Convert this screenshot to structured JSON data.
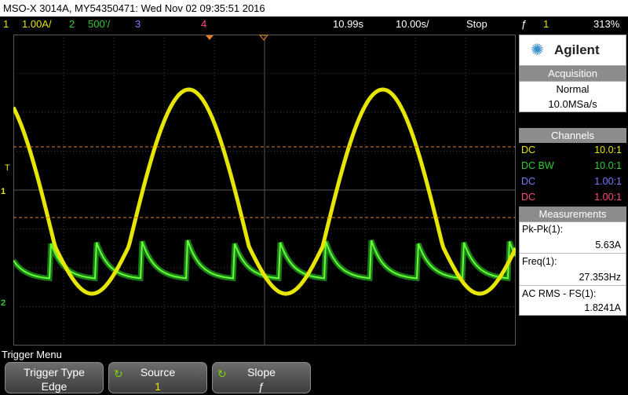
{
  "title_bar": {
    "text": "MSO-X 3014A, MY54350471: Wed Nov 02 09:35:51 2016"
  },
  "status_line": {
    "ch1_num": "1",
    "ch1_scale": "1.00A/",
    "ch2_num": "2",
    "ch2_scale": "500’/",
    "ch3_num": "3",
    "ch4_num": "4",
    "delay": "10.99s",
    "timebase": "10.00s/",
    "run_state": "Stop",
    "trigger_icon": "ƒ",
    "trigger_source": "1",
    "trigger_level": "313%"
  },
  "markers": {
    "trigger": "T",
    "ch1": "1",
    "ch2": "2"
  },
  "right_panel": {
    "brand": "Agilent",
    "acquisition": {
      "header": "Acquisition",
      "mode": "Normal",
      "rate": "10.0MSa/s"
    },
    "channels": {
      "header": "Channels",
      "rows": [
        {
          "coupling": "DC",
          "probe": "10.0:1",
          "color": "#e6e600"
        },
        {
          "coupling": "DC BW",
          "probe": "10.0:1",
          "color": "#33cc33"
        },
        {
          "coupling": "DC",
          "probe": "1.00:1",
          "color": "#7a7aff"
        },
        {
          "coupling": "DC",
          "probe": "1.00:1",
          "color": "#ff4a7a"
        }
      ]
    },
    "measurements": {
      "header": "Measurements",
      "items": [
        {
          "name": "Pk-Pk(1):",
          "value": "5.63A"
        },
        {
          "name": "Freq(1):",
          "value": "27.353Hz"
        },
        {
          "name": "AC RMS - FS(1):",
          "value": "1.8241A"
        }
      ]
    }
  },
  "menu": {
    "title": "Trigger Menu",
    "softkeys": [
      {
        "label": "Trigger Type",
        "value": "Edge"
      },
      {
        "label": "Source",
        "value": "1"
      },
      {
        "label": "Slope",
        "value": "ƒ"
      }
    ]
  },
  "colors": {
    "ch1": "#e6e600",
    "ch2": "#33cc33",
    "ch3": "#7a7aff",
    "ch4": "#ff4a7a",
    "cursor": "#e0802a"
  }
}
